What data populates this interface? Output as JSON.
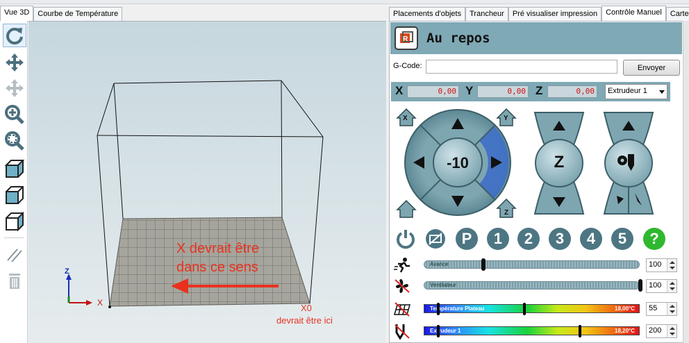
{
  "left_tabs": [
    {
      "label": "Vue 3D",
      "active": true
    },
    {
      "label": "Courbe de Température",
      "active": false
    }
  ],
  "toolbar": {
    "icons": [
      "refresh-icon",
      "move-icon",
      "move-disabled-icon",
      "zoom-in-icon",
      "zoom-fit-icon",
      "view-iso-icon",
      "view-front-icon",
      "view-top-icon",
      "parallel-lines-icon",
      "trash-icon"
    ]
  },
  "viewport": {
    "annotation_text_line1": "X devrait être",
    "annotation_text_line2": "dans ce sens",
    "x0_label": "X0",
    "x0_caption": "devrait être ici",
    "axis_x": "X",
    "axis_z": "Z",
    "annotation_color": "#e8321e"
  },
  "right_tabs": [
    {
      "label": "Placements d'objets",
      "active": false
    },
    {
      "label": "Trancheur",
      "active": false
    },
    {
      "label": "Pré visualiser impression",
      "active": false
    },
    {
      "label": "Contrôle Manuel",
      "active": true
    },
    {
      "label": "Carte SD",
      "active": false
    }
  ],
  "status": {
    "text": "Au repos"
  },
  "gcode": {
    "label": "G-Code:",
    "value": "",
    "send_label": "Envoyer"
  },
  "coords": {
    "x_label": "X",
    "x_value": "0,00",
    "y_label": "Y",
    "y_value": "0,00",
    "z_label": "Z",
    "z_value": "0,00",
    "extruder_selected": "Extrudeur 1"
  },
  "jog": {
    "step_label": "-10",
    "z_label": "Z",
    "home_x": "X",
    "home_y": "Y",
    "home_z": "Z"
  },
  "buttons_row": {
    "numbers": [
      "1",
      "2",
      "3",
      "4",
      "5"
    ],
    "p_label": "P",
    "help_label": "?"
  },
  "sliders": {
    "feed": {
      "label": "Avance",
      "value": "100"
    },
    "fan": {
      "label": "Ventilateur",
      "value": "100"
    },
    "bed": {
      "label": "Température Plateau",
      "reading": "18,00°C",
      "value": "55"
    },
    "extruder": {
      "label": "Extrudeur 1",
      "reading": "18,20°C",
      "value": "200"
    }
  },
  "colors": {
    "panel_accent": "#7fa9b5",
    "jog_ring": "#6f9aa6",
    "jog_highlight": "#3f6fc6",
    "help_green": "#2fb82f"
  }
}
